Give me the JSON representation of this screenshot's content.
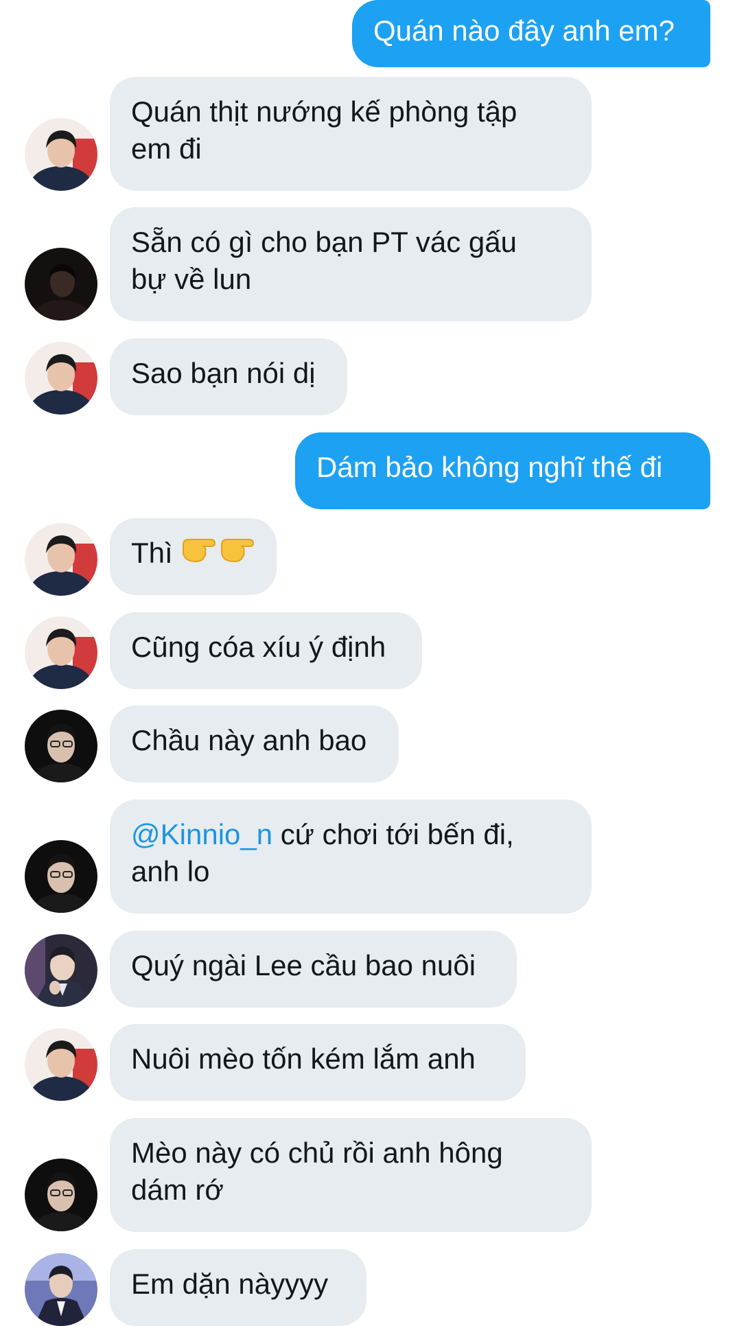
{
  "messages": [
    {
      "side": "out",
      "text": "Quán nào đây anh em?"
    },
    {
      "side": "in",
      "avatar": "avatar-a",
      "line1": "Quán thịt nướng kế phòng tập",
      "line2": "em đi"
    },
    {
      "side": "in",
      "avatar": "avatar-b",
      "line1": "Sẵn có gì cho bạn PT vác gấu",
      "line2": "bự về lun"
    },
    {
      "side": "in",
      "avatar": "avatar-a",
      "text": "Sao bạn nói dị"
    },
    {
      "side": "out",
      "text": "Dám bảo không nghĩ thế đi"
    },
    {
      "side": "in",
      "avatar": "avatar-a",
      "text": "Thì",
      "emoji": "👉👉"
    },
    {
      "side": "in",
      "avatar": "avatar-a",
      "text": "Cũng cóa xíu ý định"
    },
    {
      "side": "in",
      "avatar": "avatar-c",
      "text": "Chầu này anh bao"
    },
    {
      "side": "in",
      "avatar": "avatar-c",
      "mention": "@Kinnio_n",
      "line1_rest": " cứ chơi tới bến đi,",
      "line2": "anh lo"
    },
    {
      "side": "in",
      "avatar": "avatar-d",
      "text": "Quý ngài Lee cầu bao nuôi"
    },
    {
      "side": "in",
      "avatar": "avatar-a",
      "text": "Nuôi mèo tốn kém lắm anh"
    },
    {
      "side": "in",
      "avatar": "avatar-c",
      "line1": "Mèo này có chủ rồi anh hông",
      "line2": "dám rớ"
    },
    {
      "side": "in",
      "avatar": "avatar-e",
      "text": "Em dặn nàyyyy"
    }
  ],
  "colors": {
    "outgoing_bubble": "#1da1f2",
    "incoming_bubble": "#e6ecf0",
    "mention": "#1b95e0",
    "text": "#14171a"
  }
}
